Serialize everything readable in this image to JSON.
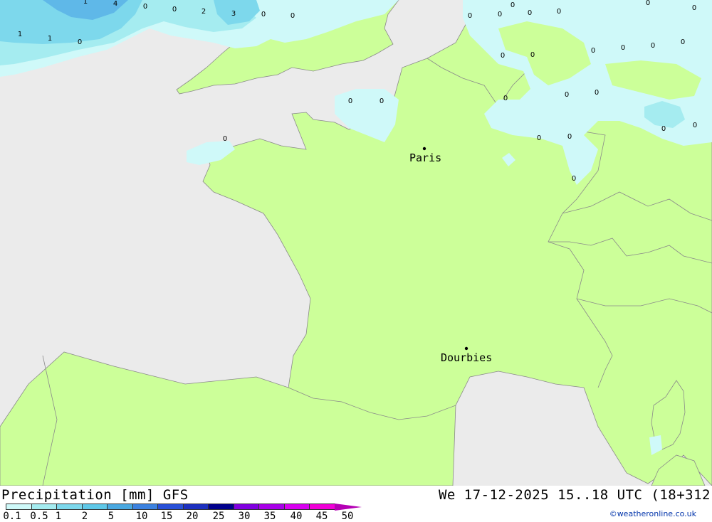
{
  "map": {
    "colors": {
      "sea": "#ebebeb",
      "land": "#ccff99",
      "precip_01": "#cff9f9",
      "precip_05": "#a5ecf0",
      "precip_1": "#7dd8ec",
      "precip_2": "#5fb8e8"
    },
    "cities": [
      {
        "name": "Paris"
      },
      {
        "name": "Dourbies"
      }
    ],
    "grid_values": [
      "1",
      "4",
      "0",
      "0",
      "2",
      "3",
      "0",
      "0",
      "1",
      "1",
      "0",
      "0",
      "0",
      "0",
      "0",
      "0",
      "0",
      "0",
      "0",
      "0",
      "0",
      "0",
      "0",
      "0",
      "0",
      "0",
      "0",
      "0",
      "0",
      "0",
      "0",
      "0",
      "0",
      "0",
      "0"
    ]
  },
  "footer": {
    "title": "Precipitation [mm] GFS",
    "date": "We 17-12-2025 15..18 UTC (18+312",
    "credit": "©weatheronline.co.uk",
    "scale": {
      "labels": [
        "0.1",
        "0.5",
        "1",
        "2",
        "5",
        "10",
        "15",
        "20",
        "25",
        "30",
        "35",
        "40",
        "45",
        "50"
      ],
      "colors": [
        "#cff9f9",
        "#a5ecf0",
        "#7dd8ec",
        "#5fc8e8",
        "#4aa8e0",
        "#3c82e0",
        "#2850d8",
        "#1c30c0",
        "#00008c",
        "#8000e0",
        "#a800e8",
        "#d800f0",
        "#f000d8",
        "#b400b4"
      ]
    }
  }
}
